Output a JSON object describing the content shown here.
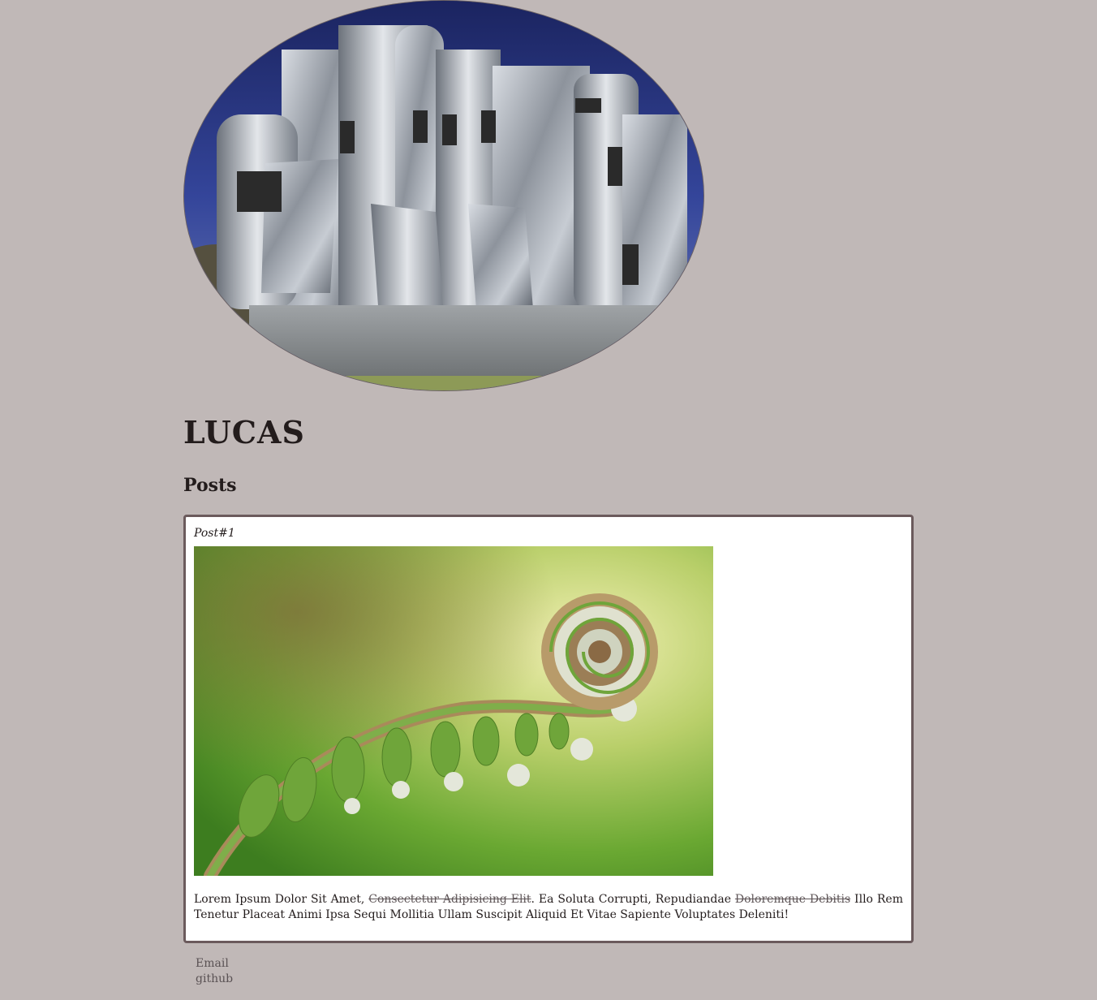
{
  "hero": {
    "image": "building-photo"
  },
  "site": {
    "title": "LUCAS"
  },
  "posts_section": {
    "title": "Posts"
  },
  "posts": [
    {
      "title": "Post#1",
      "image": "fern-fiddlehead-photo",
      "text_parts": {
        "p1": "Lorem Ipsum Dolor Sit Amet, ",
        "p2_strike": "Consectetur Adipisicing Elit",
        "p3": ". Ea Soluta Corrupti, Repudiandae ",
        "p4_strike": "Doloremque Debitis",
        "p5": " Illo Rem Tenetur Placeat Animi Ipsa Sequi Mollitia Ullam Suscipit Aliquid Et Vitae Sapiente Voluptates Deleniti!"
      }
    }
  ],
  "footer": {
    "links": [
      "Email",
      "github"
    ]
  },
  "colors": {
    "background": "#c0b8b7",
    "text": "#231c1c",
    "post_border": "#6b5a5c",
    "link": "#5a5254"
  }
}
